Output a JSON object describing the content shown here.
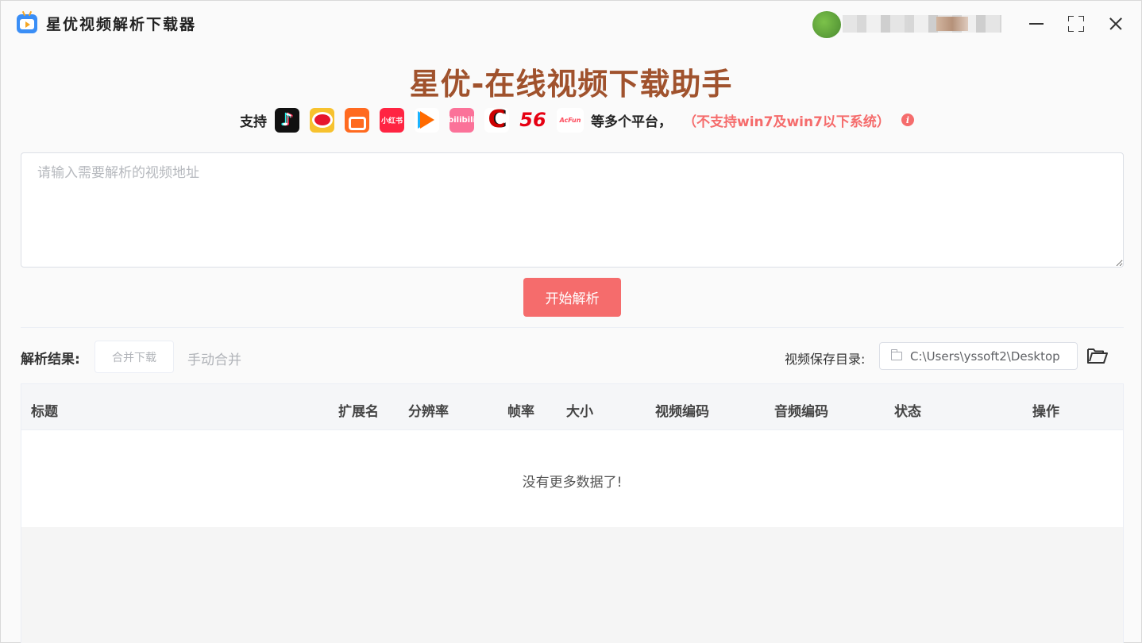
{
  "app": {
    "title": "星优视频解析下载器"
  },
  "hero": {
    "title": "星优-在线视频下载助手",
    "support_label": "支持",
    "platform_icons": [
      {
        "name": "douyin-icon"
      },
      {
        "name": "weibo-icon"
      },
      {
        "name": "kuaishou-icon"
      },
      {
        "name": "xiaohongshu-icon",
        "text": "小红书"
      },
      {
        "name": "tencent-video-icon"
      },
      {
        "name": "bilibili-icon",
        "text": "bilibili"
      },
      {
        "name": "cctv-icon"
      },
      {
        "name": "56-icon"
      },
      {
        "name": "acfun-icon"
      }
    ],
    "more_platforms": "等多个平台，",
    "warning": "（不支持win7及win7以下系统）"
  },
  "url_input": {
    "placeholder": "请输入需要解析的视频地址",
    "value": ""
  },
  "start_button": "开始解析",
  "results": {
    "label": "解析结果:",
    "merge_download": "合并下载",
    "manual_merge": "手动合并",
    "save_dir_label": "视频保存目录:",
    "save_dir_value": "C:\\Users\\yssoft2\\Desktop"
  },
  "table": {
    "columns": [
      "标题",
      "扩展名",
      "分辨率",
      "帧率",
      "大小",
      "视频编码",
      "音频编码",
      "状态",
      "操作"
    ],
    "empty_text": "没有更多数据了!"
  },
  "colors": {
    "accent": "#f56c6c",
    "hero_title": "#a0522d",
    "window_bg": "#fafafa"
  }
}
